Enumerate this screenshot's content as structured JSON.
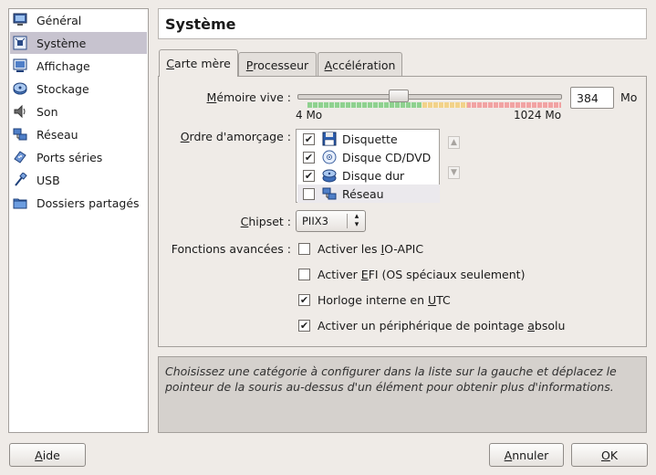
{
  "title": "Système",
  "sidebar": {
    "items": [
      {
        "label": "Général"
      },
      {
        "label": "Système"
      },
      {
        "label": "Affichage"
      },
      {
        "label": "Stockage"
      },
      {
        "label": "Son"
      },
      {
        "label": "Réseau"
      },
      {
        "label": "Ports séries"
      },
      {
        "label": "USB"
      },
      {
        "label": "Dossiers partagés"
      }
    ],
    "selected": "Système"
  },
  "tabs": {
    "motherboard": {
      "pre": "",
      "key": "C",
      "post": "arte mère"
    },
    "processor": {
      "pre": "",
      "key": "P",
      "post": "rocesseur"
    },
    "acceleration": {
      "pre": "",
      "key": "A",
      "post": "ccélération"
    },
    "active": "Carte mère"
  },
  "memory": {
    "label_pre": "",
    "label_key": "M",
    "label_post": "émoire vive :",
    "value": "384",
    "unit": "Mo",
    "min_label": "4 Mo",
    "max_label": "1024 Mo",
    "slider_fraction": 0.37
  },
  "boot": {
    "label_pre": "",
    "label_key": "O",
    "label_post": "rdre d'amorçage :",
    "items": [
      {
        "label": "Disquette",
        "checked": "✔",
        "icon": "floppy-icon"
      },
      {
        "label": "Disque CD/DVD",
        "checked": "✔",
        "icon": "optical-disc-icon"
      },
      {
        "label": "Disque dur",
        "checked": "✔",
        "icon": "hard-disk-icon"
      },
      {
        "label": "Réseau",
        "checked": "",
        "icon": "network-icon"
      }
    ]
  },
  "chipset": {
    "label_pre": "",
    "label_key": "C",
    "label_post": "hipset :",
    "value": "PIIX3"
  },
  "advanced": {
    "label": "Fonctions avancées :",
    "options": [
      {
        "pre": "Activer les ",
        "key": "I",
        "post": "O-APIC",
        "checked": ""
      },
      {
        "pre": "Activer ",
        "key": "E",
        "post": "FI (OS spéciaux seulement)",
        "checked": ""
      },
      {
        "pre": "Horloge interne en ",
        "key": "U",
        "post": "TC",
        "checked": "✔"
      },
      {
        "pre": "Activer un périphérique de pointage ",
        "key": "a",
        "post": "bsolu",
        "checked": "✔"
      }
    ]
  },
  "info_text": "Choisissez une catégorie à configurer dans la liste sur la gauche et déplacez le pointeur de la souris au-dessus d'un élément pour obtenir plus d'informations.",
  "buttons": {
    "help": {
      "pre": "",
      "key": "A",
      "post": "ide"
    },
    "cancel": {
      "pre": "",
      "key": "A",
      "post": "nnuler"
    },
    "ok": {
      "pre": "",
      "key": "O",
      "post": "K"
    }
  }
}
